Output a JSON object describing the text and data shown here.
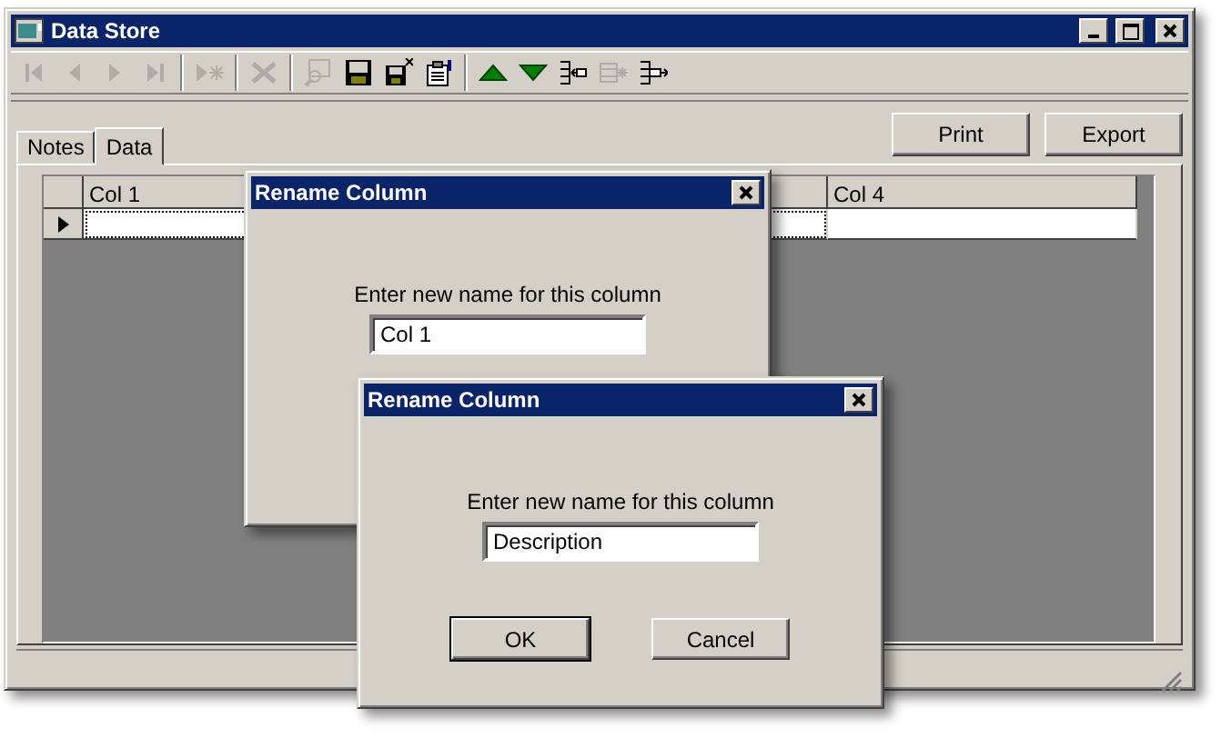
{
  "window": {
    "title": "Data Store"
  },
  "toolbar": [
    {
      "kind": "first",
      "disabled": true
    },
    {
      "kind": "prev",
      "disabled": true
    },
    {
      "kind": "next",
      "disabled": true
    },
    {
      "kind": "last",
      "disabled": true
    },
    {
      "kind": "separator"
    },
    {
      "kind": "new",
      "disabled": true
    },
    {
      "kind": "separator"
    },
    {
      "kind": "delete",
      "disabled": true
    },
    {
      "kind": "separator"
    },
    {
      "kind": "find",
      "disabled": true
    },
    {
      "kind": "save",
      "disabled": false
    },
    {
      "kind": "save-close",
      "disabled": false
    },
    {
      "kind": "properties",
      "disabled": false
    },
    {
      "kind": "separator"
    },
    {
      "kind": "up",
      "disabled": false
    },
    {
      "kind": "down",
      "disabled": false
    },
    {
      "kind": "insert-column",
      "disabled": false
    },
    {
      "kind": "insert-column-mid",
      "disabled": true
    },
    {
      "kind": "append-column",
      "disabled": false
    }
  ],
  "tabs": [
    {
      "label": "Notes",
      "selected": false
    },
    {
      "label": "Data",
      "selected": true
    }
  ],
  "actions": [
    "Print",
    "Export"
  ],
  "grid": {
    "columns": [
      "Col 1",
      "Col 4"
    ]
  },
  "dialogs": [
    {
      "title": "Rename Column",
      "prompt": "Enter new name for this column",
      "value": "Col 1"
    },
    {
      "title": "Rename Column",
      "prompt": "Enter new name for this column",
      "value": "Description",
      "buttons": [
        "OK",
        "Cancel"
      ]
    }
  ]
}
